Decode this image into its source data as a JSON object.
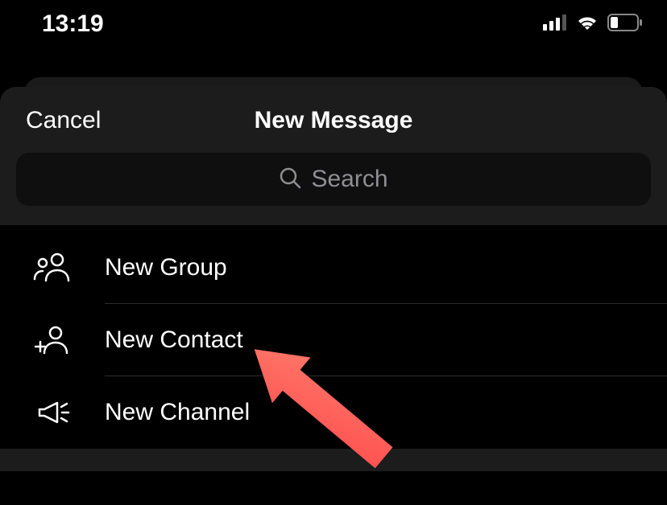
{
  "statusBar": {
    "time": "13:19"
  },
  "modal": {
    "cancel": "Cancel",
    "title": "New Message"
  },
  "search": {
    "placeholder": "Search"
  },
  "options": {
    "newGroup": "New Group",
    "newContact": "New Contact",
    "newChannel": "New Channel"
  }
}
